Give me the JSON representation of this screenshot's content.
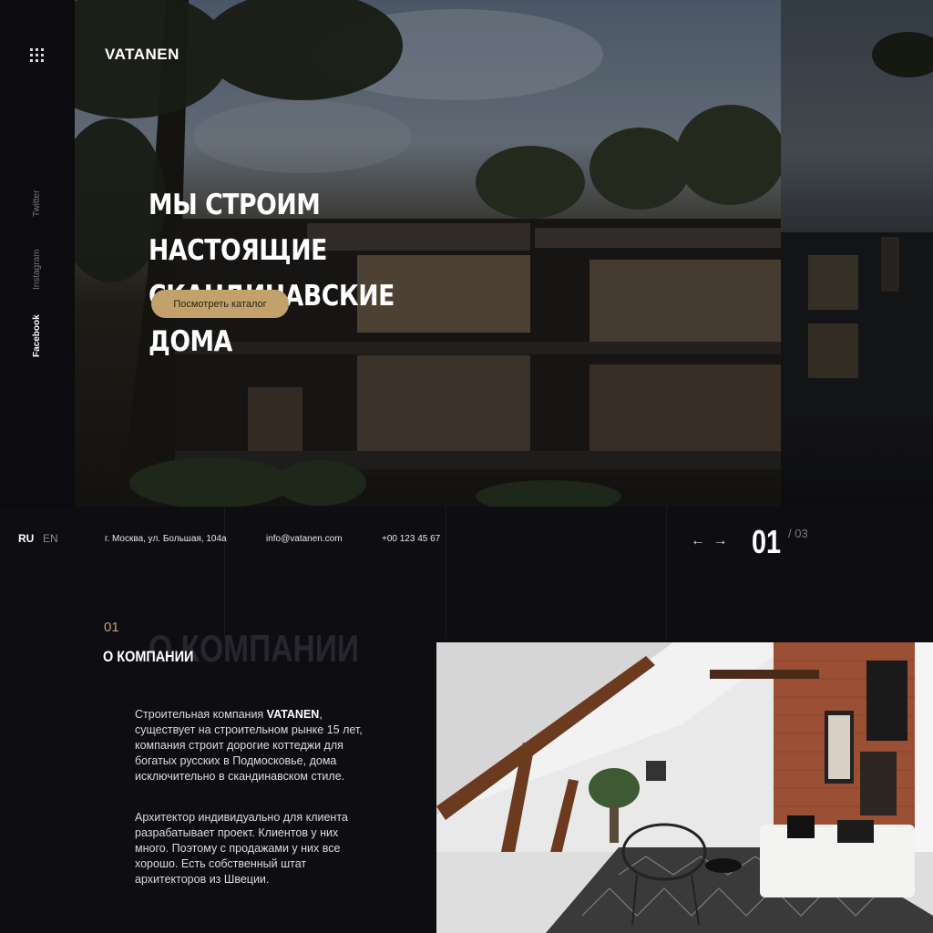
{
  "brand": "VATANEN",
  "social": [
    "Twitter",
    "Instagram",
    "Facebook"
  ],
  "social_active": "Facebook",
  "hero": {
    "headline_line1": "Мы строим настоящие",
    "headline_line2": "скандинавские дома",
    "cta_label": "Посмотреть каталог"
  },
  "languages": [
    "RU",
    "EN"
  ],
  "contact": {
    "address": "г. Москва, ул. Большая, 104а",
    "email": "info@vatanen.com",
    "phone": "+00 123 45 67"
  },
  "slider": {
    "arrows": "← →",
    "current": "01",
    "total": "/ 03"
  },
  "about": {
    "number": "01",
    "title": "О компании",
    "bg_title": "О компании",
    "para1_brand": "VATANEN",
    "para1_pre": "Строительная компания ",
    "para1_post": ", существует на строительном рынке 15 лет, компания строит дорогие коттеджи для богатых русских в Подмосковье, дома исключительно в скандинавском стиле.",
    "para2": "Архитектор индивидуально для клиента разрабатывает проект. Клиентов у них много. Поэтому с продажами у них все хорошо. Есть собственный штат архитекторов из Швеции."
  },
  "colors": {
    "accent": "#c2a26a",
    "background": "#0d0d12"
  },
  "icons": {
    "menu": "grid-menu-icon"
  }
}
